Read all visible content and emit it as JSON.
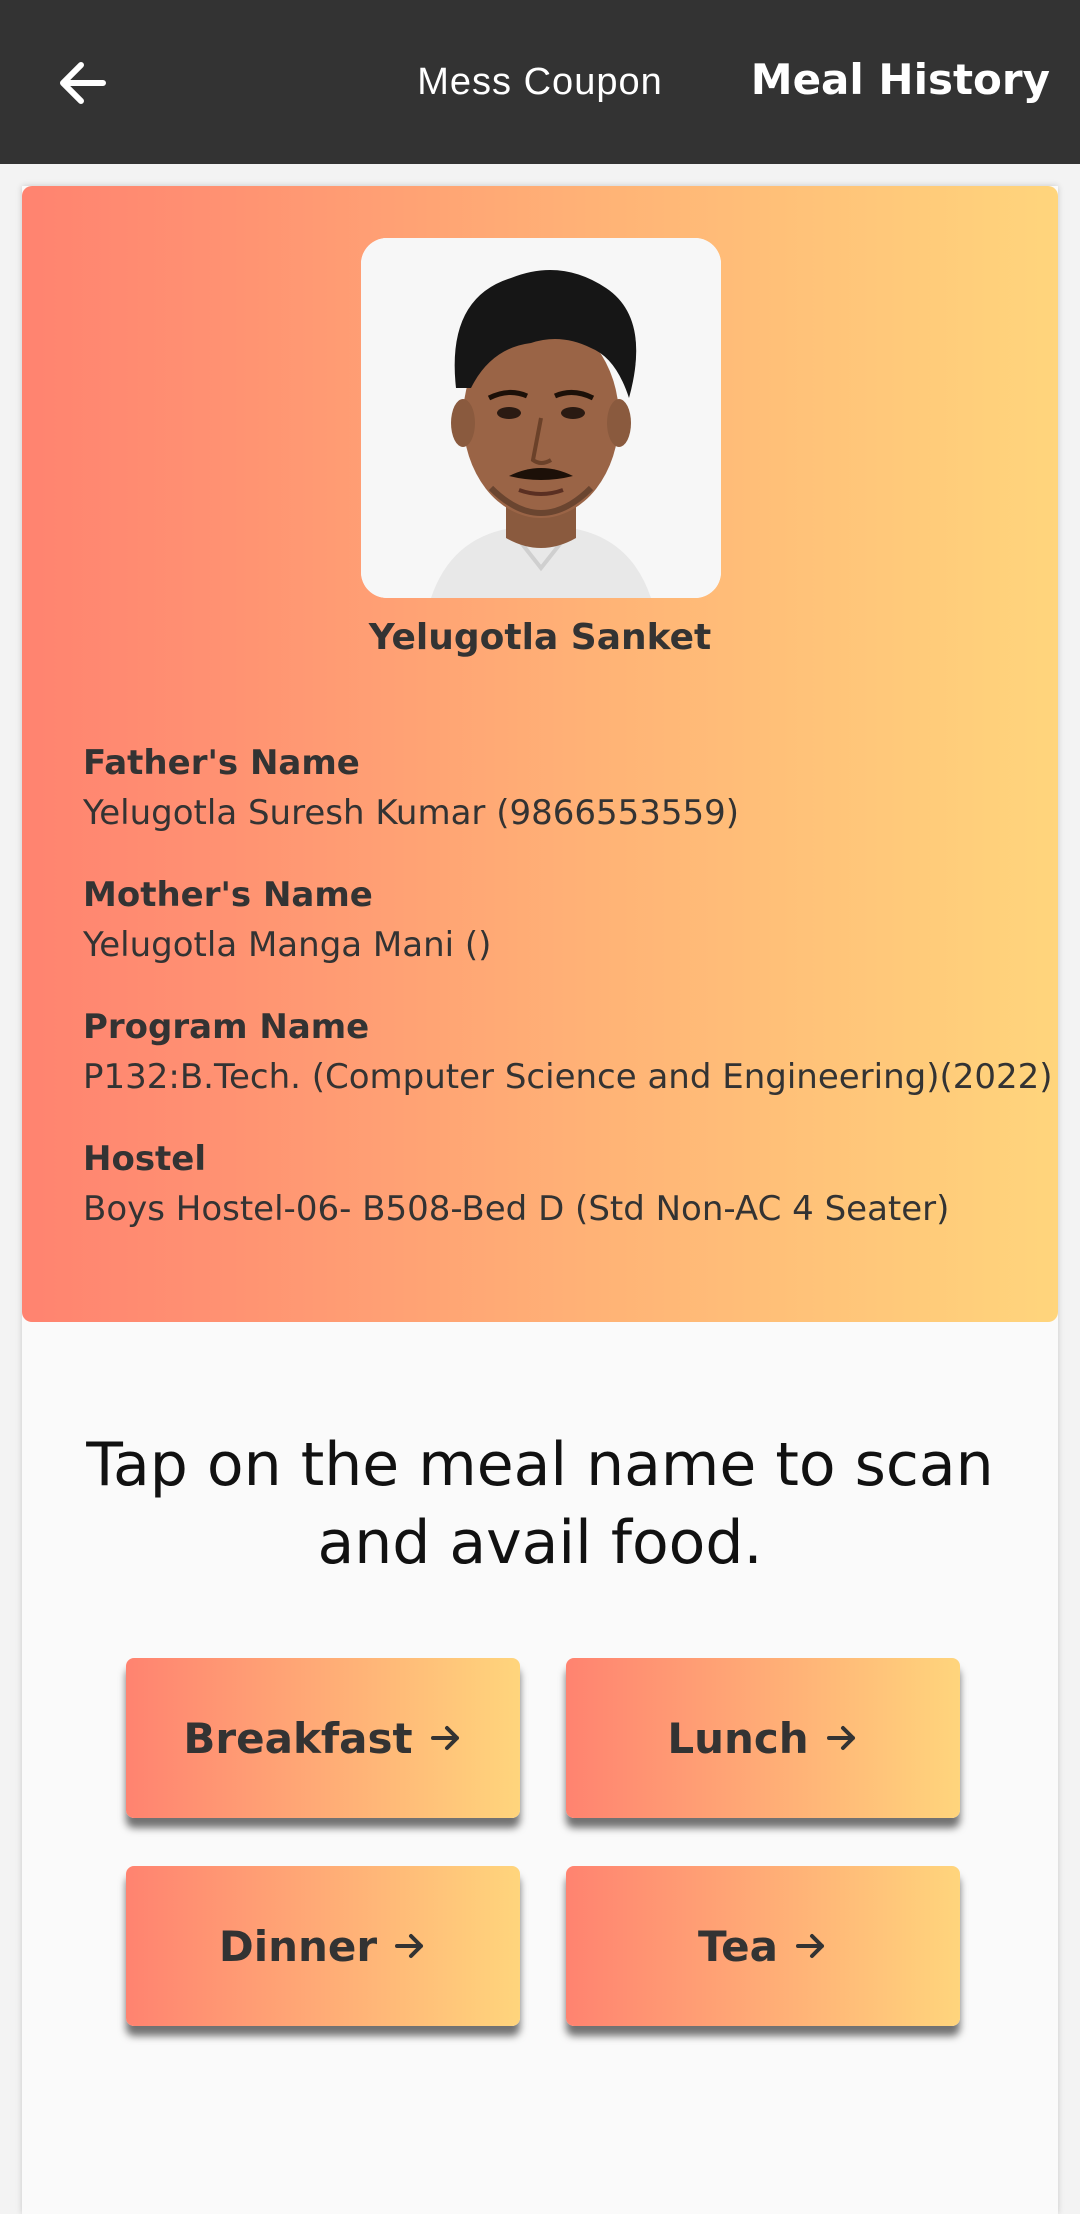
{
  "appbar": {
    "title": "Mess Coupon",
    "action_label": "Meal History",
    "back_icon": "arrow-left-icon"
  },
  "profile": {
    "name": "Yelugotla Sanket",
    "fields": [
      {
        "label": "Father's Name",
        "value": "Yelugotla Suresh Kumar (9866553559)"
      },
      {
        "label": "Mother's Name",
        "value": "Yelugotla Manga Mani ()"
      },
      {
        "label": "Program Name",
        "value": "P132:B.Tech. (Computer Science and Engineering)(2022)"
      },
      {
        "label": "Hostel",
        "value": "Boys Hostel-06- B508-Bed D (Std Non-AC 4 Seater)"
      }
    ]
  },
  "instruction": "Tap on the meal name to scan and avail food.",
  "meals": [
    {
      "label": "Breakfast"
    },
    {
      "label": "Lunch"
    },
    {
      "label": "Dinner"
    },
    {
      "label": "Tea"
    }
  ],
  "colors": {
    "appbar": "#333333",
    "gradient_start": "#ff8370",
    "gradient_end": "#ffd57c"
  }
}
